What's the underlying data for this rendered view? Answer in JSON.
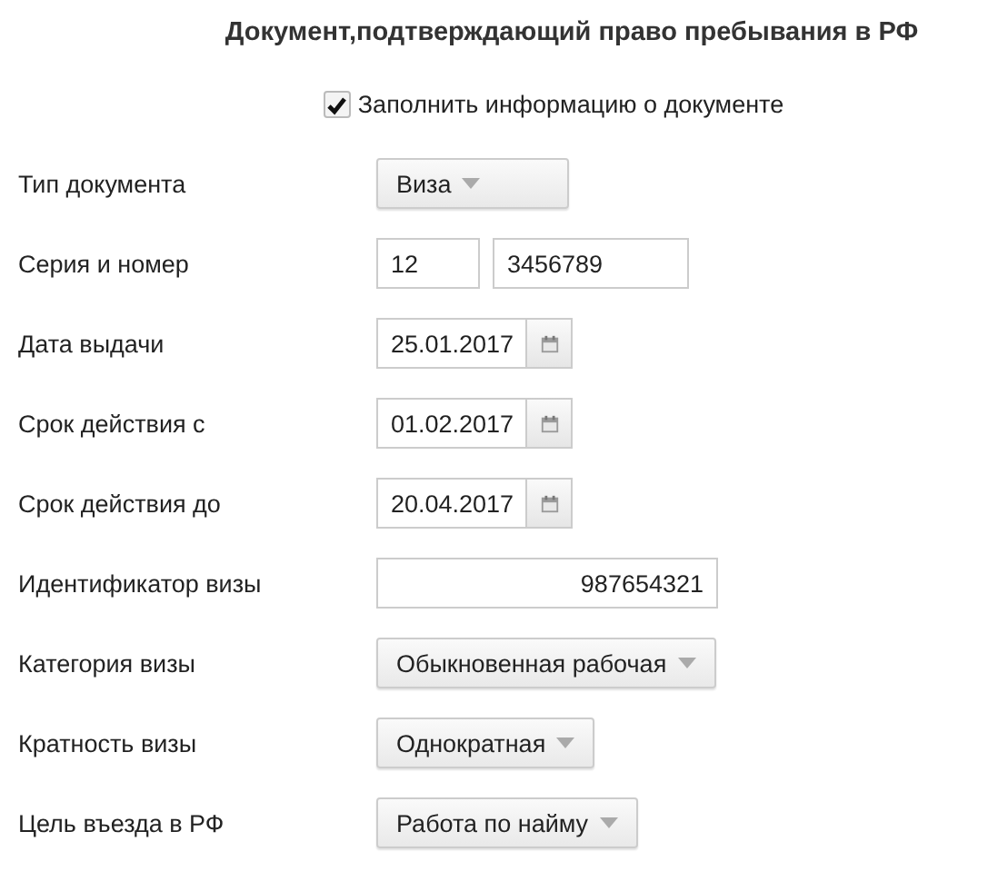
{
  "title": "Документ,подтверждающий право пребывания в РФ",
  "fill_checkbox": {
    "label": "Заполнить информацию о документе",
    "checked": true
  },
  "fields": [
    {
      "kind": "dropdown",
      "label": "Тип документа",
      "value": "Виза"
    },
    {
      "kind": "pair",
      "label": "Серия и номер",
      "values": [
        "12",
        "3456789"
      ]
    },
    {
      "kind": "date",
      "label": "Дата выдачи",
      "value": "25.01.2017"
    },
    {
      "kind": "date",
      "label": "Срок действия с",
      "value": "01.02.2017"
    },
    {
      "kind": "date",
      "label": "Срок действия до",
      "value": "20.04.2017"
    },
    {
      "kind": "text",
      "label": "Идентификатор визы",
      "value": "987654321"
    },
    {
      "kind": "dropdown",
      "label": "Категория визы",
      "value": "Обыкновенная рабочая"
    },
    {
      "kind": "dropdown",
      "label": "Кратность визы",
      "value": "Однократная"
    },
    {
      "kind": "dropdown",
      "label": "Цель въезда в РФ",
      "value": "Работа по найму"
    }
  ]
}
